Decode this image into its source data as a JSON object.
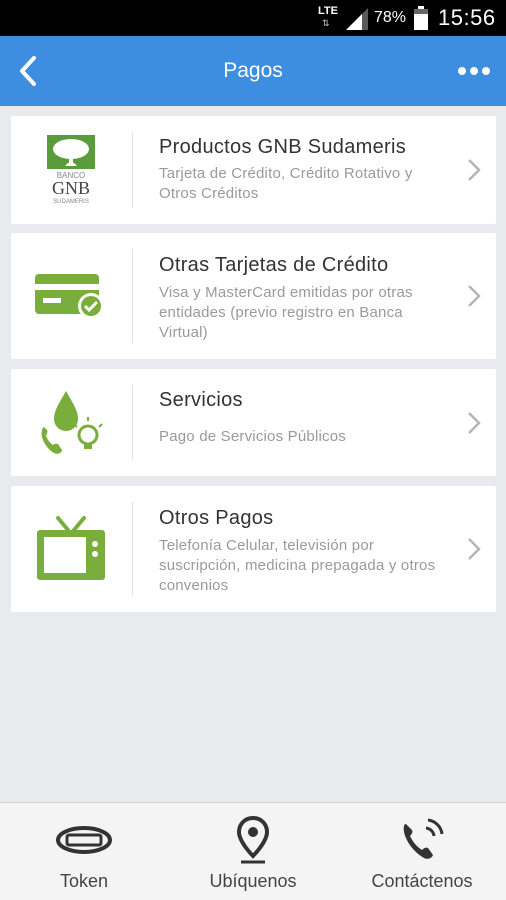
{
  "status_bar": {
    "network": "LTE",
    "battery_percent": "78%",
    "time": "15:56"
  },
  "header": {
    "title": "Pagos",
    "back_icon": "chevron-left-icon",
    "more_icon": "more-dots-icon",
    "background": "#3d8ee1"
  },
  "colors": {
    "accent_green": "#7aae3c",
    "card_title": "#333333",
    "card_subtitle": "#9a9a9a"
  },
  "cards": [
    {
      "title": "Productos GNB Sudameris",
      "subtitle": "Tarjeta de Crédito, Crédito Rotativo y Otros Créditos",
      "icon": "banco-gnb-logo",
      "logo_text_top": "BANCO",
      "logo_text_main": "GNB",
      "logo_text_bottom": "SUDAMERIS"
    },
    {
      "title": "Otras Tarjetas de Crédito",
      "subtitle": "Visa y MasterCard emitidas por otras entidades (previo registro en Banca Virtual)",
      "icon": "credit-card-check-icon"
    },
    {
      "title": "Servicios",
      "subtitle": "Pago de Servicios Públicos",
      "icon": "utilities-icon"
    },
    {
      "title": "Otros Pagos",
      "subtitle": "Telefonía Celular, televisión por suscripción, medicina prepagada y otros convenios",
      "icon": "television-icon"
    }
  ],
  "bottom_nav": [
    {
      "label": "Token",
      "icon": "token-icon"
    },
    {
      "label": "Ubíquenos",
      "icon": "location-pin-icon"
    },
    {
      "label": "Contáctenos",
      "icon": "phone-call-icon"
    }
  ]
}
